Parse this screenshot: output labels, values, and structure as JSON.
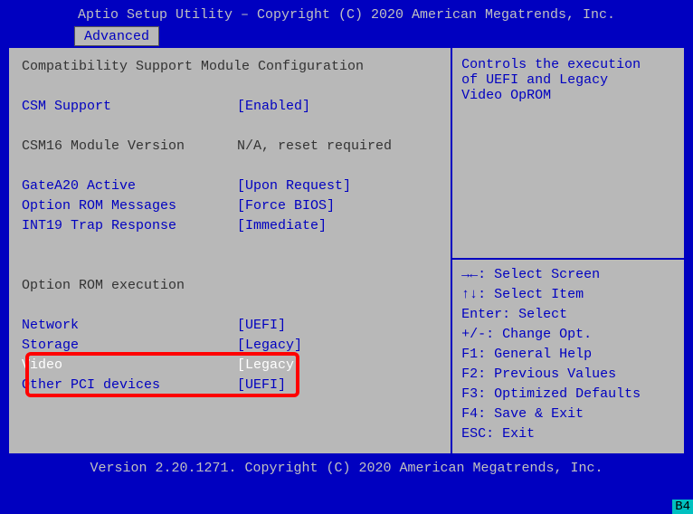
{
  "header": {
    "title": "Aptio Setup Utility – Copyright (C) 2020 American Megatrends, Inc.",
    "tab": "Advanced"
  },
  "main": {
    "section_title": "Compatibility Support Module Configuration",
    "csm_support": {
      "label": "CSM Support",
      "value": "[Enabled]"
    },
    "csm16": {
      "label": "CSM16 Module Version",
      "value": "N/A, reset required"
    },
    "gatea20": {
      "label": "GateA20 Active",
      "value": "[Upon Request]"
    },
    "oprom_msg": {
      "label": "Option ROM Messages",
      "value": "[Force BIOS]"
    },
    "int19": {
      "label": "INT19 Trap Response",
      "value": "[Immediate]"
    },
    "oprom_exec": "Option ROM execution",
    "network": {
      "label": "Network",
      "value": "[UEFI]"
    },
    "storage": {
      "label": "Storage",
      "value": "[Legacy]"
    },
    "video": {
      "label": "Video",
      "value": "[Legacy]"
    },
    "other_pci": {
      "label": "Other PCI devices",
      "value": "[UEFI]"
    }
  },
  "help": {
    "desc1": "Controls the execution",
    "desc2": "of UEFI and Legacy",
    "desc3": "Video OpROM",
    "keys": {
      "k1": "→←: Select Screen",
      "k2": "↑↓: Select Item",
      "k3": "Enter: Select",
      "k4": "+/-: Change Opt.",
      "k5": "F1: General Help",
      "k6": "F2: Previous Values",
      "k7": "F3: Optimized Defaults",
      "k8": "F4: Save & Exit",
      "k9": "ESC: Exit"
    }
  },
  "footer": {
    "text": "Version 2.20.1271. Copyright (C) 2020 American Megatrends, Inc.",
    "corner": "B4"
  }
}
